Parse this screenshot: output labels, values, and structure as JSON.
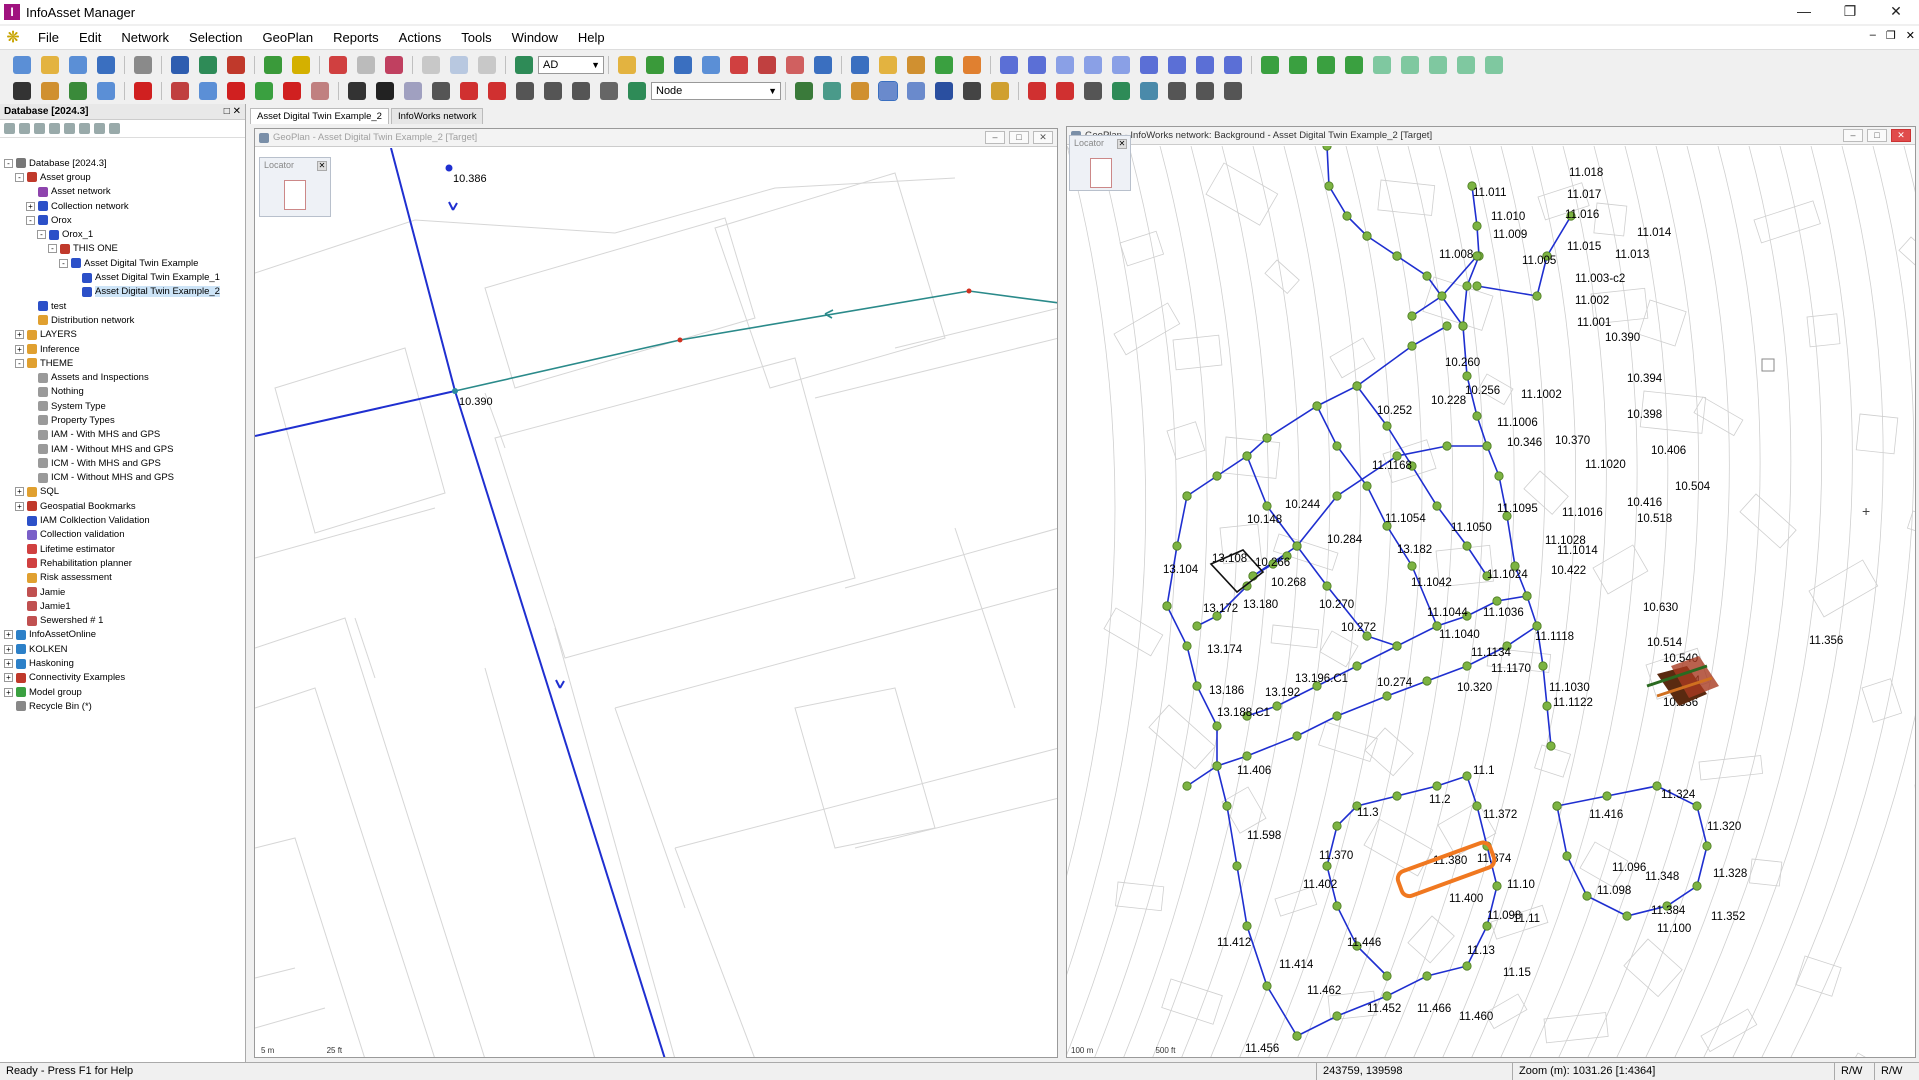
{
  "app": {
    "title": "InfoAsset Manager"
  },
  "menu": [
    "File",
    "Edit",
    "Network",
    "Selection",
    "GeoPlan",
    "Reports",
    "Actions",
    "Tools",
    "Window",
    "Help"
  ],
  "toolbar": {
    "layer_combo": "AD",
    "object_combo": "Node"
  },
  "left_panel": {
    "title": "Database [2024.3]",
    "tree": [
      {
        "label": "Database [2024.3]",
        "depth": 0,
        "toggle": "-",
        "icon": "#777777"
      },
      {
        "label": "Asset group",
        "depth": 1,
        "toggle": "-",
        "icon": "#c0392b"
      },
      {
        "label": "Asset network",
        "depth": 2,
        "toggle": "",
        "icon": "#8e44ad"
      },
      {
        "label": "Collection network",
        "depth": 2,
        "toggle": "+",
        "icon": "#2c50c8"
      },
      {
        "label": "Orox",
        "depth": 2,
        "toggle": "-",
        "icon": "#2c50c8"
      },
      {
        "label": "Orox_1",
        "depth": 3,
        "toggle": "-",
        "icon": "#2c50c8"
      },
      {
        "label": "THIS ONE",
        "depth": 4,
        "toggle": "-",
        "icon": "#c0392b"
      },
      {
        "label": "Asset Digital Twin Example",
        "depth": 5,
        "toggle": "-",
        "icon": "#2c50c8"
      },
      {
        "label": "Asset Digital Twin Example_1",
        "depth": 6,
        "toggle": "",
        "icon": "#2c50c8"
      },
      {
        "label": "Asset Digital Twin Example_2",
        "depth": 6,
        "toggle": "",
        "icon": "#2c50c8",
        "selected": true
      },
      {
        "label": "test",
        "depth": 2,
        "toggle": "",
        "icon": "#2c50c8"
      },
      {
        "label": "Distribution network",
        "depth": 2,
        "toggle": "",
        "icon": "#e0a030"
      },
      {
        "label": "LAYERS",
        "depth": 1,
        "toggle": "+",
        "icon": "#e0a030"
      },
      {
        "label": "Inference",
        "depth": 1,
        "toggle": "+",
        "icon": "#e0a030"
      },
      {
        "label": "THEME",
        "depth": 1,
        "toggle": "-",
        "icon": "#e0a030"
      },
      {
        "label": "Assets and Inspections",
        "depth": 2,
        "toggle": "",
        "icon": "#9a9a9a"
      },
      {
        "label": "Nothing",
        "depth": 2,
        "toggle": "",
        "icon": "#9a9a9a"
      },
      {
        "label": "System Type",
        "depth": 2,
        "toggle": "",
        "icon": "#9a9a9a"
      },
      {
        "label": "Property Types",
        "depth": 2,
        "toggle": "",
        "icon": "#9a9a9a"
      },
      {
        "label": "IAM - With MHS and GPS",
        "depth": 2,
        "toggle": "",
        "icon": "#9a9a9a"
      },
      {
        "label": "IAM - Without MHS and GPS",
        "depth": 2,
        "toggle": "",
        "icon": "#9a9a9a"
      },
      {
        "label": "ICM - With MHS and GPS",
        "depth": 2,
        "toggle": "",
        "icon": "#9a9a9a"
      },
      {
        "label": "ICM - Without MHS and GPS",
        "depth": 2,
        "toggle": "",
        "icon": "#9a9a9a"
      },
      {
        "label": "SQL",
        "depth": 1,
        "toggle": "+",
        "icon": "#e0a030"
      },
      {
        "label": "Geospatial Bookmarks",
        "depth": 1,
        "toggle": "+",
        "icon": "#c0392b"
      },
      {
        "label": "IAM Colklection Validation",
        "depth": 1,
        "toggle": "",
        "icon": "#2c50c8"
      },
      {
        "label": "Collection validation",
        "depth": 1,
        "toggle": "",
        "icon": "#7a5fc8"
      },
      {
        "label": "Lifetime estimator",
        "depth": 1,
        "toggle": "",
        "icon": "#d04040"
      },
      {
        "label": "Rehabilitation planner",
        "depth": 1,
        "toggle": "",
        "icon": "#d04040"
      },
      {
        "label": "Risk assessment",
        "depth": 1,
        "toggle": "",
        "icon": "#e0a030"
      },
      {
        "label": "Jamie",
        "depth": 1,
        "toggle": "",
        "icon": "#c05050"
      },
      {
        "label": "Jamie1",
        "depth": 1,
        "toggle": "",
        "icon": "#c05050"
      },
      {
        "label": "Sewershed # 1",
        "depth": 1,
        "toggle": "",
        "icon": "#c05050"
      },
      {
        "label": "InfoAssetOnline",
        "depth": 0,
        "toggle": "+",
        "icon": "#2c80c8"
      },
      {
        "label": "KOLKEN",
        "depth": 0,
        "toggle": "+",
        "icon": "#2c80c8"
      },
      {
        "label": "Haskoning",
        "depth": 0,
        "toggle": "+",
        "icon": "#2c80c8"
      },
      {
        "label": "Connectivity Examples",
        "depth": 0,
        "toggle": "+",
        "icon": "#c0392b"
      },
      {
        "label": "Model group",
        "depth": 0,
        "toggle": "+",
        "icon": "#3aa040"
      },
      {
        "label": "Recycle Bin (*)",
        "depth": 0,
        "toggle": "",
        "icon": "#888888"
      }
    ]
  },
  "tabs": [
    "Asset Digital Twin Example_2",
    "InfoWorks network"
  ],
  "left_window": {
    "title": "GeoPlan - Asset Digital Twin Example_2 [Target]",
    "locator": "Locator",
    "labels": [
      "10.386",
      "10.390"
    ],
    "scale": [
      "5 m",
      "25 ft"
    ]
  },
  "right_window": {
    "title": "GeoPlan - InfoWorks network: Background - Asset Digital Twin Example_2 [Target]",
    "locator": "Locator",
    "scale": [
      "100 m",
      "500 ft"
    ],
    "labels": [
      "11.018",
      "11.017",
      "11.016",
      "11.011",
      "11.010",
      "11.009",
      "11.008",
      "11.005",
      "11.015",
      "11.014",
      "11.013",
      "11.003-c2",
      "11.002",
      "11.001",
      "10.390",
      "10.394",
      "10.398",
      "10.406",
      "10.504",
      "10.416",
      "10.518",
      "10.260",
      "10.256",
      "11.1002",
      "10.228",
      "11.1006",
      "10.252",
      "10.346",
      "10.370",
      "11.1020",
      "11.1168",
      "10.244",
      "10.148",
      "11.1054",
      "11.1095",
      "11.1016",
      "11.1028",
      "11.1050",
      "11.1014",
      "13.108",
      "13.104",
      "10.266",
      "10.284",
      "13.182",
      "10.268",
      "11.1042",
      "11.1024",
      "10.422",
      "11.1044",
      "11.1036",
      "10.270",
      "13.172",
      "13.180",
      "10.272",
      "11.1040",
      "10.630",
      "10.514",
      "11.1118",
      "11.1134",
      "11.1170",
      "10.274",
      "10.320",
      "10.540",
      "10.654",
      "13.174",
      "13.196.C1",
      "11.1030",
      "11.1122",
      "10.536",
      "13.186",
      "13.192",
      "13.188.C1",
      "11.406",
      "11.1",
      "11.2",
      "11.3",
      "11.372",
      "11.598",
      "11.370",
      "11.380",
      "11.374",
      "11.402",
      "11.10",
      "11.400",
      "11.098",
      "11.11",
      "11.412",
      "11.13",
      "11.446",
      "11.414",
      "11.15",
      "11.462",
      "11.466",
      "11.452",
      "11.460",
      "11.456",
      "11.416",
      "11.324",
      "11.320",
      "11.096",
      "11.348",
      "11.328",
      "11.098",
      "11.384",
      "11.352",
      "11.100",
      "11.356"
    ]
  },
  "colors": {
    "pipe": "#1f2fd0",
    "lateral": "#2a8a8a",
    "node": "#7cb342",
    "accent": "#a0127f"
  },
  "status": {
    "text": "Ready - Press F1 for Help",
    "coords": "243759, 139598",
    "zoom": "Zoom (m): 1031.26 [1:4364]",
    "mode1": "R/W",
    "mode2": "R/W"
  }
}
